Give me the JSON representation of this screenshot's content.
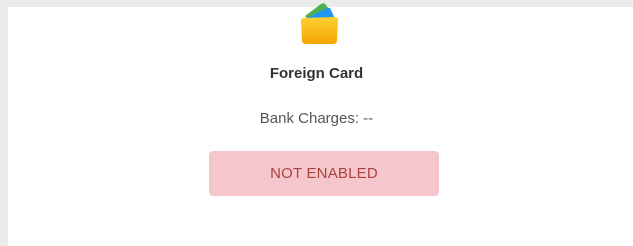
{
  "payment_method": {
    "icon": "card-wallet-icon",
    "title": "Foreign Card",
    "bank_charges": "Bank Charges: --",
    "status": "NOT ENABLED"
  },
  "colors": {
    "page_background": "#ebebeb",
    "card_background": "#ffffff",
    "status_background": "#f5c6cb",
    "status_text": "#a94442"
  }
}
